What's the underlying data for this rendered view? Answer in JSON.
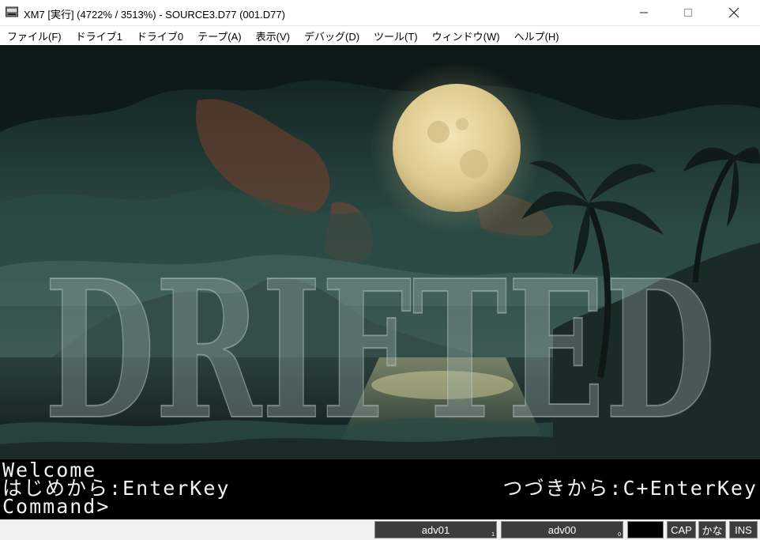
{
  "window": {
    "title": "XM7 [実行] (4722% / 3513%) - SOURCE3.D77 (001.D77)",
    "icon": "floppy-drive-icon",
    "controls": [
      "minimize-icon",
      "maximize-icon",
      "close-icon"
    ]
  },
  "menu": {
    "items": [
      "ファイル(F)",
      "ドライブ1",
      "ドライブ0",
      "テープ(A)",
      "表示(V)",
      "デバッグ(D)",
      "ツール(T)",
      "ウィンドウ(W)",
      "ヘルプ(H)"
    ]
  },
  "screen": {
    "title_logo": "DRIFTED",
    "console": {
      "line1": "Welcome",
      "line2_left": "はじめから:EnterKey",
      "line2_right": "つづきから:C+EnterKey",
      "line3": "Command>"
    }
  },
  "status": {
    "drive1": "adv01",
    "drive1_num": "1",
    "drive0": "adv00",
    "drive0_num": "0",
    "cap": "CAP",
    "kana": "かな",
    "ins": "INS"
  },
  "colors": {
    "accent": "#3c3c3c",
    "moon": "#e8d9a0",
    "sky": "#2f4a44"
  }
}
